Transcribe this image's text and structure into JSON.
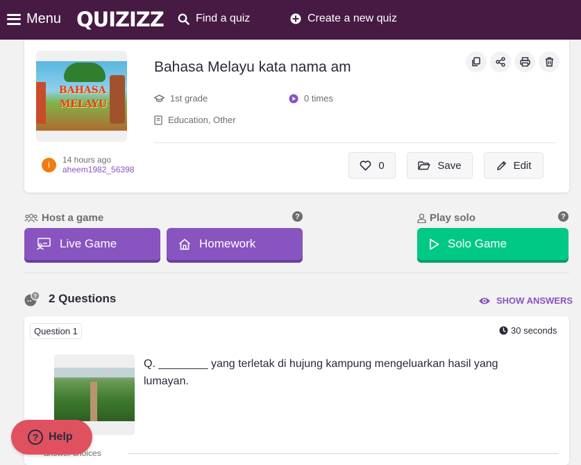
{
  "nav": {
    "menu_label": "Menu",
    "logo": "QUIZIZZ",
    "find_label": "Find a quiz",
    "create_label": "Create a new quiz"
  },
  "quiz": {
    "title": "Bahasa Melayu kata nama am",
    "thumb_line1": "BAHASA",
    "thumb_line2": "MELAYU",
    "grade": "1st grade",
    "plays": "0 times",
    "subject": "Education, Other",
    "author_initial": "i",
    "time_ago": "14 hours ago",
    "author": "aheem1982_56398",
    "likes": "0",
    "save_label": "Save",
    "edit_label": "Edit"
  },
  "game": {
    "host_label": "Host a game",
    "solo_label": "Play solo",
    "help_glyph": "?",
    "live_label": "Live Game",
    "homework_label": "Homework",
    "solo_game_label": "Solo Game"
  },
  "questions": {
    "count_label": "2 Questions",
    "show_answers": "SHOW ANSWERS",
    "items": [
      {
        "badge": "Question 1",
        "time": "30 seconds",
        "text": "Q. ________ yang terletak di hujung kampung mengeluarkan hasil yang lumayan.",
        "answer_choices_label": "answer choices"
      }
    ]
  },
  "help": {
    "label": "Help",
    "glyph": "?"
  },
  "colors": {
    "nav": "#461a42",
    "purple": "#8854c0",
    "green": "#00c985",
    "help": "#e05160"
  }
}
